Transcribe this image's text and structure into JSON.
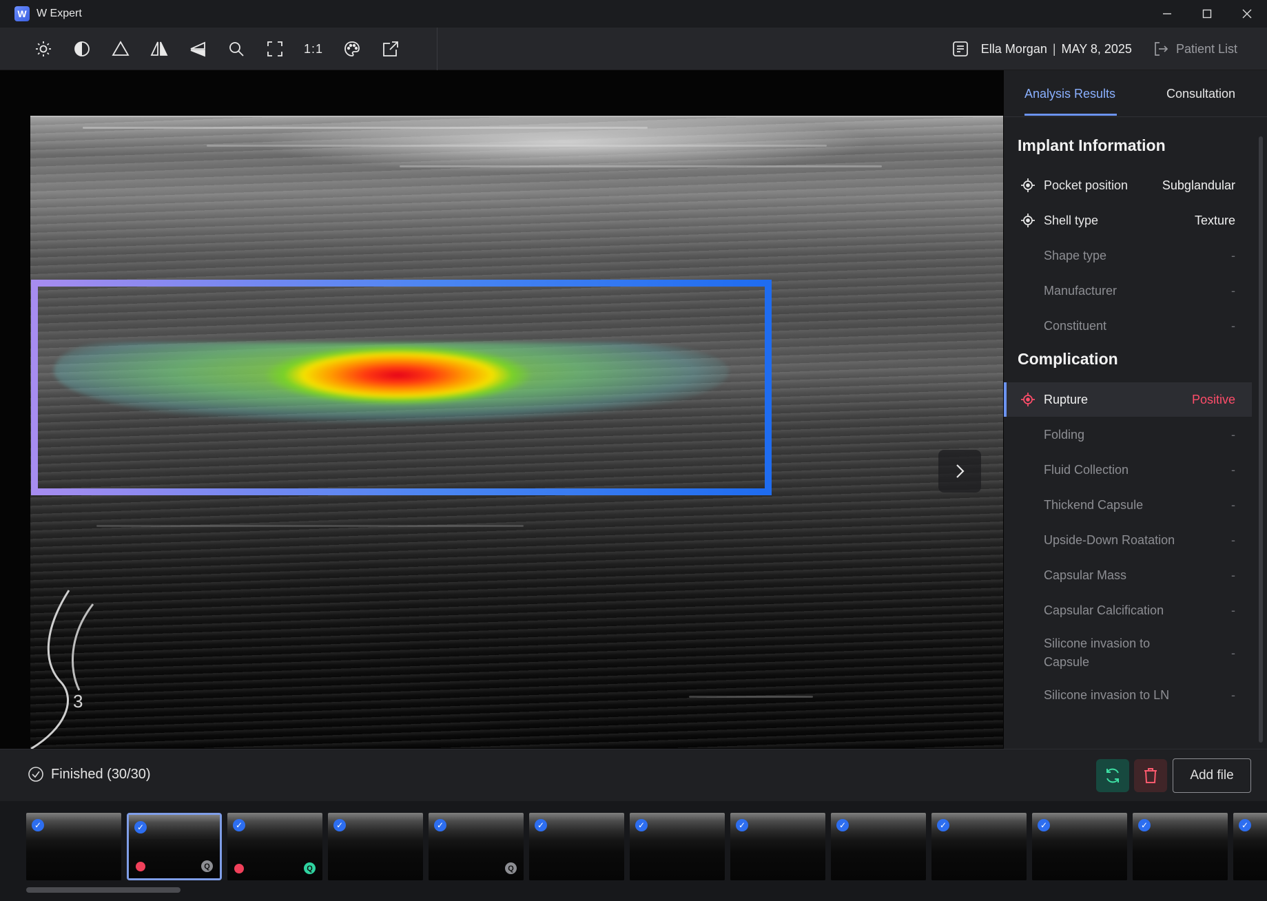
{
  "window": {
    "title": "W Expert",
    "logo_letter": "W"
  },
  "toolbar": {
    "tools": [
      "brightness-icon",
      "contrast-icon",
      "triangle-icon",
      "flip-horizontal-icon",
      "flip-vertical-icon",
      "zoom-icon",
      "fullscreen-icon",
      "actual-size",
      "palette-icon",
      "export-icon"
    ],
    "actual_size_label": "1:1"
  },
  "patient": {
    "name": "Ella Morgan",
    "separator": "|",
    "date": "MAY 8, 2025",
    "patient_list_label": "Patient List"
  },
  "viewer": {
    "probe_marker_label": "3"
  },
  "panel": {
    "tabs": [
      {
        "label": "Analysis Results",
        "active": true
      },
      {
        "label": "Consultation",
        "active": false
      }
    ],
    "implant_title": "Implant Information",
    "implant_rows": [
      {
        "label": "Pocket position",
        "value": "Subglandular",
        "icon": "target-icon"
      },
      {
        "label": "Shell type",
        "value": "Texture",
        "icon": "target-icon"
      },
      {
        "label": "Shape type",
        "value": "-"
      },
      {
        "label": "Manufacturer",
        "value": "-"
      },
      {
        "label": "Constituent",
        "value": "-"
      }
    ],
    "complication_title": "Complication",
    "complication_rows": [
      {
        "label": "Rupture",
        "value": "Positive",
        "icon": "target-icon",
        "highlight": true
      },
      {
        "label": "Folding",
        "value": "-"
      },
      {
        "label": "Fluid Collection",
        "value": "-"
      },
      {
        "label": "Thickend Capsule",
        "value": "-"
      },
      {
        "label": "Upside-Down Roatation",
        "value": "-"
      },
      {
        "label": "Capsular Mass",
        "value": "-"
      },
      {
        "label": "Capsular Calcification",
        "value": "-"
      },
      {
        "label": "Silicone invasion to Capsule",
        "value": "-"
      },
      {
        "label": "Silicone invasion to LN",
        "value": "-"
      }
    ]
  },
  "status": {
    "text": "Finished (30/30)",
    "add_file_label": "Add file"
  },
  "thumbnails": [
    {
      "checked": true,
      "selected": false,
      "red": false,
      "q": null
    },
    {
      "checked": true,
      "selected": true,
      "red": true,
      "q": "gray"
    },
    {
      "checked": true,
      "selected": false,
      "red": true,
      "q": "green"
    },
    {
      "checked": true,
      "selected": false,
      "red": false,
      "q": null
    },
    {
      "checked": true,
      "selected": false,
      "red": false,
      "q": "gray"
    },
    {
      "checked": true,
      "selected": false,
      "red": false,
      "q": null
    },
    {
      "checked": true,
      "selected": false,
      "red": false,
      "q": null
    },
    {
      "checked": true,
      "selected": false,
      "red": false,
      "q": null
    },
    {
      "checked": true,
      "selected": false,
      "red": false,
      "q": null
    },
    {
      "checked": true,
      "selected": false,
      "red": false,
      "q": null
    },
    {
      "checked": true,
      "selected": false,
      "red": false,
      "q": null
    },
    {
      "checked": true,
      "selected": false,
      "red": false,
      "q": null
    },
    {
      "checked": true,
      "selected": false,
      "red": false,
      "q": null
    }
  ],
  "thumb_badge_letter": "Q",
  "colors": {
    "accent": "#6c93f0",
    "positive": "#ff4d6a",
    "refresh": "#3ee0a4"
  }
}
